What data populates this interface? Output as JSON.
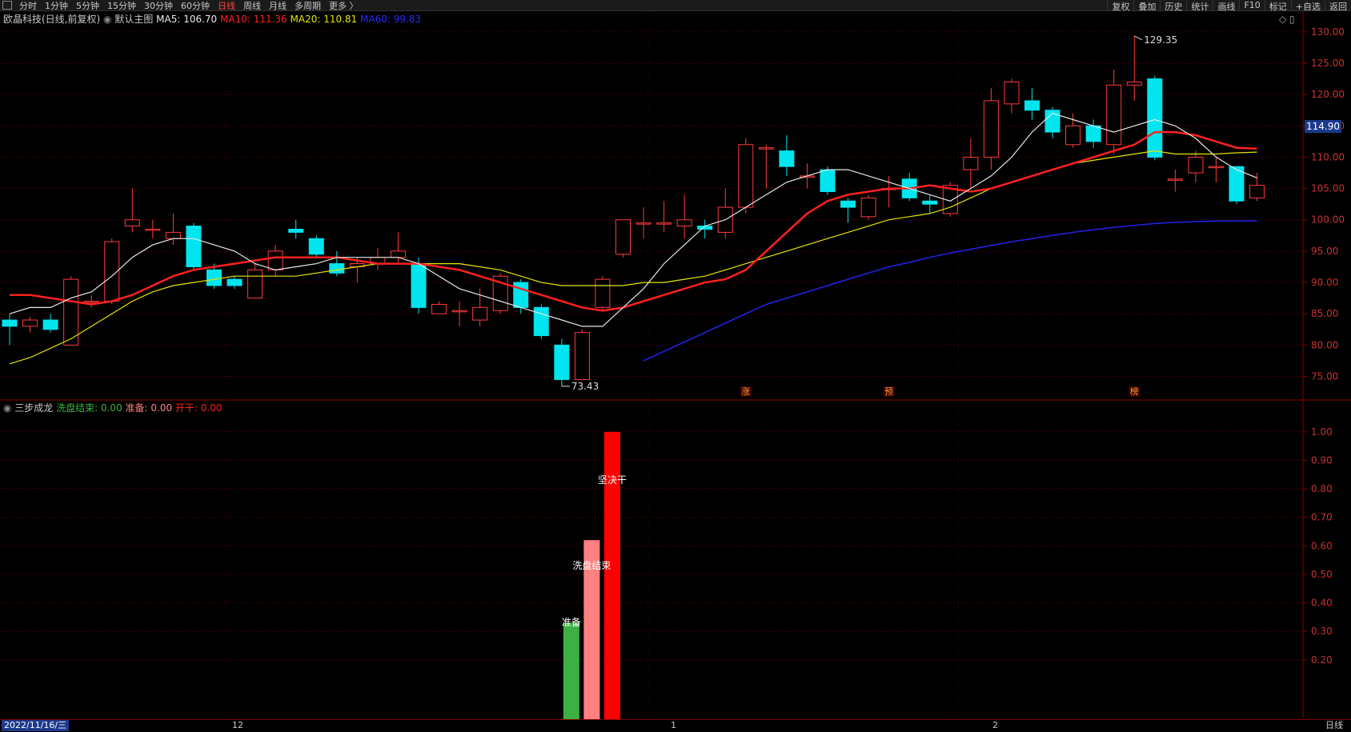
{
  "toolbar": {
    "timeframes": [
      "分时",
      "1分钟",
      "5分钟",
      "15分钟",
      "30分钟",
      "60分钟",
      "日线",
      "周线",
      "月线",
      "多周期",
      "更多 〉"
    ],
    "active_index": 6,
    "right_buttons": [
      "复权",
      "叠加",
      "历史",
      "统计",
      "画线",
      "F10",
      "标记",
      "+自选",
      "返回"
    ]
  },
  "main_header": {
    "stock": "欧晶科技(日线,前复权)",
    "template": "默认主图",
    "ma5": "MA5: 106.70",
    "ma10": "MA10: 111.36",
    "ma20": "MA20: 110.81",
    "ma60": "MA60: 99.83"
  },
  "indicator_header": {
    "name": "三步成龙",
    "xipan": "洗盘结束: 0.00",
    "zhunbei": "准备: 0.00",
    "kaigan": "开干: 0.00"
  },
  "price_badge": "114.90",
  "high_label": "129.35",
  "low_label": "73.43",
  "event_labels": [
    "涨",
    "预",
    "榜"
  ],
  "bar_labels": [
    "准备",
    "洗盘结束",
    "坚决干"
  ],
  "footer": {
    "date": "2022/11/16/三",
    "month_labels": [
      "12",
      "1",
      "2"
    ],
    "period": "日线"
  },
  "colors": {
    "up": "#ff3b3b",
    "down": "#00e5ee",
    "ma5": "#e8e8e8",
    "ma10": "#ff2020",
    "ma20": "#e6e600",
    "ma60": "#2222ee",
    "green": "#3cb043",
    "pink": "#ff8080",
    "red": "#ff0000"
  },
  "chart_data": [
    {
      "type": "candlestick",
      "ylim": [
        72,
        131
      ],
      "yticks": [
        75,
        80,
        85,
        90,
        95,
        100,
        105,
        110,
        115,
        120,
        125,
        130
      ],
      "candles": [
        {
          "o": 84,
          "c": 83,
          "h": 85,
          "l": 80
        },
        {
          "o": 83,
          "c": 84,
          "h": 84.5,
          "l": 82
        },
        {
          "o": 84,
          "c": 82.5,
          "h": 85,
          "l": 82
        },
        {
          "o": 80,
          "c": 90.5,
          "h": 91,
          "l": 80
        },
        {
          "o": 87,
          "c": 87,
          "h": 88,
          "l": 86
        },
        {
          "o": 87,
          "c": 96.5,
          "h": 97,
          "l": 86.5
        },
        {
          "o": 99,
          "c": 100,
          "h": 105,
          "l": 98
        },
        {
          "o": 98.5,
          "c": 98.5,
          "h": 100,
          "l": 97
        },
        {
          "o": 97,
          "c": 98,
          "h": 101,
          "l": 96
        },
        {
          "o": 99,
          "c": 92.5,
          "h": 99.5,
          "l": 92
        },
        {
          "o": 92,
          "c": 89.5,
          "h": 93,
          "l": 89
        },
        {
          "o": 90.5,
          "c": 89.5,
          "h": 91,
          "l": 89
        },
        {
          "o": 87.5,
          "c": 92,
          "h": 93,
          "l": 87.5
        },
        {
          "o": 92,
          "c": 95,
          "h": 96,
          "l": 91
        },
        {
          "o": 98.5,
          "c": 98,
          "h": 100,
          "l": 97
        },
        {
          "o": 97,
          "c": 94.5,
          "h": 97.5,
          "l": 94
        },
        {
          "o": 93,
          "c": 91.5,
          "h": 95,
          "l": 91
        },
        {
          "o": 92.5,
          "c": 93,
          "h": 94,
          "l": 90
        },
        {
          "o": 93,
          "c": 94,
          "h": 95.5,
          "l": 92
        },
        {
          "o": 94,
          "c": 95,
          "h": 98,
          "l": 93
        },
        {
          "o": 93,
          "c": 86,
          "h": 94,
          "l": 85
        },
        {
          "o": 85,
          "c": 86.5,
          "h": 87,
          "l": 85
        },
        {
          "o": 85.5,
          "c": 85.5,
          "h": 87,
          "l": 83
        },
        {
          "o": 84,
          "c": 86,
          "h": 89,
          "l": 83
        },
        {
          "o": 85.5,
          "c": 91,
          "h": 91.5,
          "l": 85
        },
        {
          "o": 90,
          "c": 86,
          "h": 90.5,
          "l": 85
        },
        {
          "o": 86,
          "c": 81.5,
          "h": 86.5,
          "l": 81
        },
        {
          "o": 80,
          "c": 74.5,
          "h": 81,
          "l": 73.43
        },
        {
          "o": 74.5,
          "c": 82,
          "h": 82.5,
          "l": 74.5
        },
        {
          "o": 86,
          "c": 90.5,
          "h": 91,
          "l": 85.5
        },
        {
          "o": 94.5,
          "c": 100,
          "h": 100,
          "l": 94
        },
        {
          "o": 99.5,
          "c": 99.5,
          "h": 102,
          "l": 97
        },
        {
          "o": 99.5,
          "c": 99.5,
          "h": 103,
          "l": 98
        },
        {
          "o": 99,
          "c": 100,
          "h": 104,
          "l": 97
        },
        {
          "o": 99,
          "c": 98.5,
          "h": 100,
          "l": 97
        },
        {
          "o": 98,
          "c": 102,
          "h": 105,
          "l": 97
        },
        {
          "o": 102,
          "c": 112,
          "h": 113,
          "l": 101
        },
        {
          "o": 111.5,
          "c": 111.5,
          "h": 112,
          "l": 105
        },
        {
          "o": 111,
          "c": 108.5,
          "h": 113.5,
          "l": 107
        },
        {
          "o": 107,
          "c": 107,
          "h": 109,
          "l": 105
        },
        {
          "o": 108,
          "c": 104.5,
          "h": 108.5,
          "l": 104
        },
        {
          "o": 103,
          "c": 102,
          "h": 103.5,
          "l": 99.5
        },
        {
          "o": 100.5,
          "c": 103.5,
          "h": 104,
          "l": 100
        },
        {
          "o": 105,
          "c": 105,
          "h": 107,
          "l": 102
        },
        {
          "o": 106.5,
          "c": 103.5,
          "h": 107.5,
          "l": 103
        },
        {
          "o": 103,
          "c": 102.5,
          "h": 104,
          "l": 101
        },
        {
          "o": 101,
          "c": 105.5,
          "h": 106,
          "l": 100.5
        },
        {
          "o": 108,
          "c": 110,
          "h": 113,
          "l": 105
        },
        {
          "o": 110,
          "c": 119,
          "h": 121,
          "l": 108
        },
        {
          "o": 118.5,
          "c": 122,
          "h": 122.5,
          "l": 117
        },
        {
          "o": 119,
          "c": 117.5,
          "h": 121,
          "l": 116
        },
        {
          "o": 117.5,
          "c": 114,
          "h": 118,
          "l": 113
        },
        {
          "o": 112,
          "c": 115,
          "h": 117,
          "l": 111.5
        },
        {
          "o": 115,
          "c": 112.5,
          "h": 116,
          "l": 111.5
        },
        {
          "o": 112,
          "c": 121.5,
          "h": 124,
          "l": 110.5
        },
        {
          "o": 121.5,
          "c": 122,
          "h": 129.35,
          "l": 119
        },
        {
          "o": 122.5,
          "c": 110,
          "h": 123,
          "l": 109.5
        },
        {
          "o": 106.5,
          "c": 106.5,
          "h": 108,
          "l": 104.5
        },
        {
          "o": 107.5,
          "c": 110,
          "h": 111,
          "l": 106
        },
        {
          "o": 108.5,
          "c": 108.5,
          "h": 110,
          "l": 106
        },
        {
          "o": 108.5,
          "c": 103,
          "h": 108.5,
          "l": 102.5
        },
        {
          "o": 103.5,
          "c": 105.5,
          "h": 107.5,
          "l": 103
        }
      ],
      "ma5": [
        85,
        86,
        86,
        87.5,
        88.5,
        91,
        94,
        96,
        97,
        97,
        96,
        95,
        93,
        92,
        92.5,
        93,
        94,
        94,
        94,
        94,
        93,
        91,
        89,
        88,
        87,
        86,
        85,
        84,
        83,
        83,
        86,
        89,
        93,
        96,
        99,
        100,
        102,
        104,
        106,
        107,
        108,
        108,
        107,
        106,
        105,
        104,
        103,
        105,
        107,
        110,
        114,
        117,
        116,
        115,
        114,
        115,
        116,
        115,
        113,
        110,
        108,
        106.7
      ],
      "ma10": [
        88,
        88,
        87.5,
        87,
        86.5,
        87,
        88,
        89.5,
        91,
        92,
        92.5,
        93,
        93.5,
        94,
        94,
        94,
        94,
        93.5,
        93,
        93,
        93,
        92.5,
        92,
        91,
        90,
        89,
        88,
        87,
        86,
        85.5,
        86,
        87,
        88,
        89,
        90,
        90.5,
        92,
        95,
        98,
        101,
        103,
        104,
        104.5,
        105,
        105,
        105.5,
        105,
        104.5,
        105,
        106,
        107,
        108,
        109,
        110,
        111,
        112,
        114,
        114,
        113.5,
        112.5,
        111.5,
        111.36
      ],
      "ma20": [
        77,
        78,
        79.5,
        81,
        83,
        85,
        87,
        88.5,
        89.5,
        90,
        90.5,
        91,
        91,
        91,
        91,
        91.5,
        92,
        92.5,
        93,
        93,
        93,
        93,
        93,
        92.5,
        92,
        91,
        90,
        89.5,
        89.5,
        89.5,
        89.5,
        90,
        90,
        90.5,
        91,
        92,
        93,
        94,
        95,
        96,
        97,
        98,
        99,
        100,
        100.5,
        101,
        102,
        103.5,
        105,
        106,
        107,
        108,
        109,
        109.5,
        110,
        110.5,
        111,
        110.5,
        110.5,
        110.5,
        110.7,
        110.81
      ],
      "ma60_start_index": 31,
      "ma60": [
        77.5,
        79,
        80.5,
        82,
        83.5,
        85,
        86.5,
        87.5,
        88.5,
        89.5,
        90.5,
        91.5,
        92.5,
        93.2,
        94,
        94.7,
        95.3,
        95.9,
        96.5,
        97,
        97.5,
        98,
        98.4,
        98.8,
        99.1,
        99.4,
        99.6,
        99.7,
        99.8,
        99.83,
        99.83
      ]
    },
    {
      "type": "bar",
      "title": "三步成龙",
      "ylim": [
        0,
        1.05
      ],
      "yticks": [
        0.2,
        0.3,
        0.4,
        0.5,
        0.6,
        0.7,
        0.8,
        0.9,
        1.0
      ],
      "series": [
        {
          "name": "准备",
          "index": 27,
          "value": 0.33
        },
        {
          "name": "洗盘结束",
          "index": 28,
          "value": 0.62
        },
        {
          "name": "开干",
          "index": 29,
          "value": 1.0
        }
      ]
    }
  ]
}
